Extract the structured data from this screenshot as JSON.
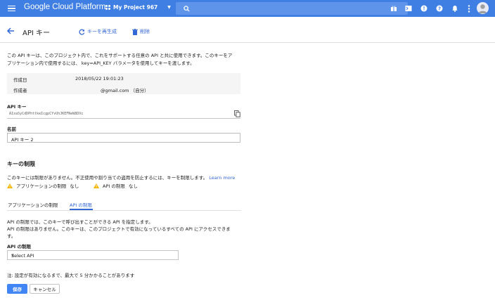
{
  "topbar": {
    "brand": "Google Cloud Platform",
    "project": "My Project 967"
  },
  "header": {
    "title": "API キー",
    "regenerate_label": "キーを再生成",
    "delete_label": "削除"
  },
  "intro": {
    "line1": "この API キーは、このプロジェクト内で、これをサポートする任意の API と共に使用できます。このキーをア",
    "line2": "プリケーション内で使用するには、 key=API_KEY パラメータを使用してキーを渡します。"
  },
  "meta": {
    "created_label": "作成日",
    "created_value": "2018/05/22 19:01:23",
    "creator_label": "作成者",
    "creator_value": "@gmail.com （自分）"
  },
  "api_key": {
    "label": "API キー",
    "value": "AIzaSyCdDPhttkeIcgpCYvUhJKEFNeW8DVc"
  },
  "name": {
    "label": "名前",
    "value": "API キー 2"
  },
  "restrictions": {
    "title": "キーの制限",
    "description": "このキーには制限がありません。不正使用や割り当ての盗用を防止するには、キーを制限します。",
    "learn_more": "Learn more",
    "app_restriction": "アプリケーションの制限",
    "app_restriction_value": "なし",
    "api_restriction": "API の制限",
    "api_restriction_value": "なし"
  },
  "tabs": [
    {
      "label": "アプリケーションの制限"
    },
    {
      "label": "API の制限"
    }
  ],
  "api_tab": {
    "line1": "API の制限では、このキーで呼び出すことができる API を指定します。",
    "line2": "API の制限はありません。このキーは、このプロジェクトで有効になっているすべての API にアクセスできま",
    "line3": "す。",
    "select_label": "API の制限",
    "select_value": "Select API"
  },
  "note": "注: 設定が有効になるまで、最大で 5 分かかることがあります",
  "footer": {
    "save_label": "保存",
    "cancel_label": "キャンセル"
  },
  "colors": {
    "topbar": "#3f7fe4",
    "accent": "#3367d6",
    "warning": "#f4b400",
    "primary_button": "#4285f4"
  },
  "icons": {
    "menu": "menu-icon",
    "search": "search-icon",
    "back": "back-arrow-icon",
    "refresh": "refresh-icon",
    "trash": "trash-icon",
    "copy": "copy-icon",
    "warning": "warning-icon"
  }
}
